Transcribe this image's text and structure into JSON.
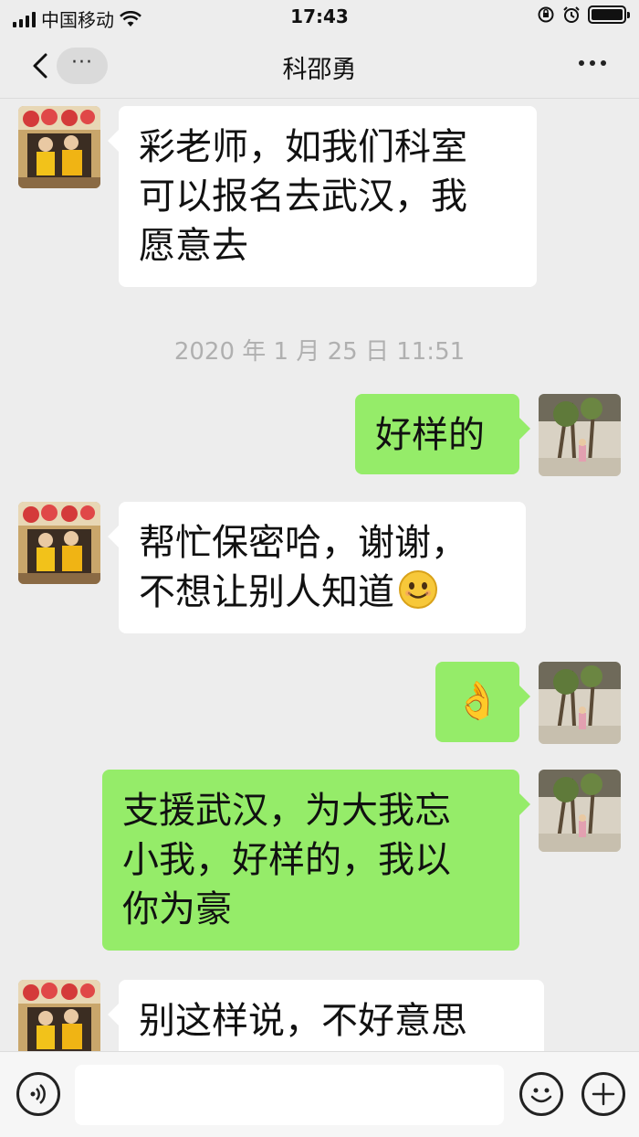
{
  "status_bar": {
    "carrier": "中国移动",
    "time": "17:43"
  },
  "nav": {
    "more_pill": "···",
    "title": "科邵勇"
  },
  "messages": [
    {
      "side": "in",
      "text_lines": [
        "彩老师，如我们科室",
        "可以报名去武汉，我",
        "愿意去"
      ]
    },
    {
      "type": "timestamp",
      "text": "2020 年 1 月 25 日 11:51"
    },
    {
      "side": "out",
      "text": "好样的"
    },
    {
      "side": "in",
      "text_lines": [
        "帮忙保密哈，谢谢，",
        "不想让别人知道"
      ],
      "trailing_emoji": "smile-emoji"
    },
    {
      "side": "out",
      "emoji": "👌"
    },
    {
      "side": "out",
      "text_lines": [
        "支援武汉，为大我忘",
        "小我，好样的，我以",
        "你为豪"
      ]
    },
    {
      "side": "in",
      "text": "别这样说，不好意思"
    }
  ],
  "input_bar": {
    "voice_icon": "voice-icon",
    "emoji_icon": "emoji-icon",
    "plus_icon": "plus-icon",
    "placeholder": ""
  },
  "colors": {
    "background": "#ededed",
    "incoming_bubble": "#ffffff",
    "outgoing_bubble": "#95ec69",
    "timestamp": "#b0b0b0"
  }
}
